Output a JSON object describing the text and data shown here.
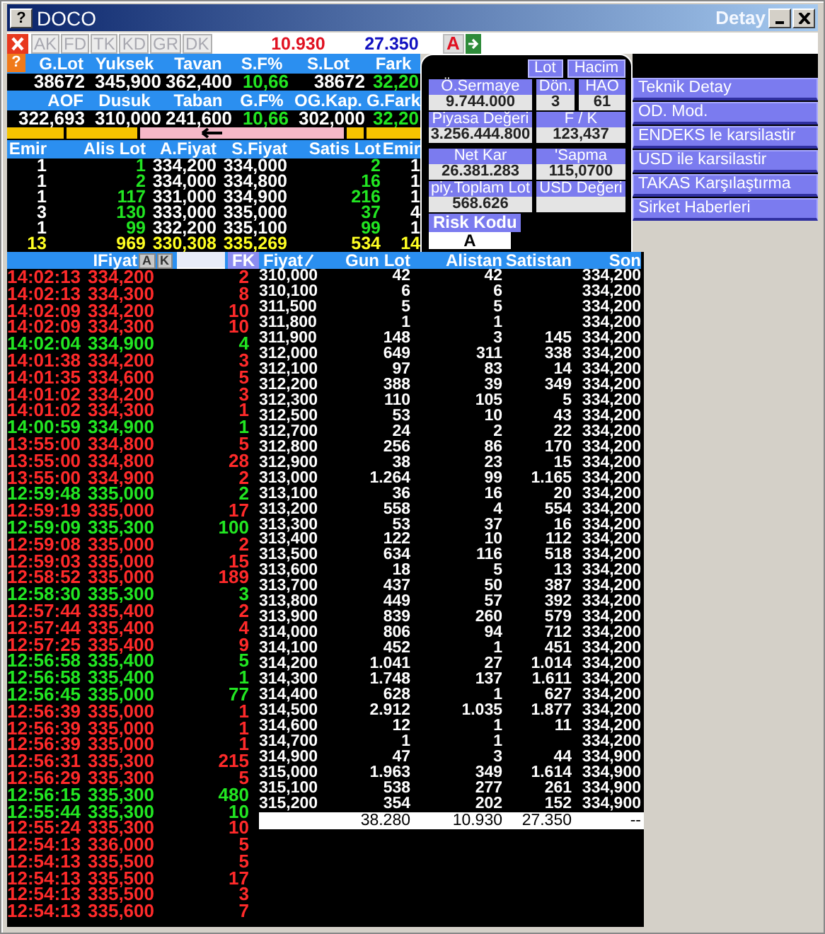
{
  "window": {
    "help_button": "?",
    "title": "DOCO",
    "detail_title": "Detay"
  },
  "toolbar": {
    "tabs": [
      {
        "label": "AK",
        "disabled": true
      },
      {
        "label": "FD",
        "disabled": true
      },
      {
        "label": "TK",
        "disabled": true
      },
      {
        "label": "KD",
        "disabled": true
      },
      {
        "label": "GR",
        "disabled": true
      },
      {
        "label": "DK",
        "disabled": true
      }
    ],
    "buy_total": "10.930",
    "sell_total": "27.350",
    "a_button": "A"
  },
  "stats": {
    "help_button": "?",
    "items": [
      {
        "label": "G.Lot",
        "value": "38672",
        "positive": false
      },
      {
        "label": "Yuksek",
        "value": "345,900",
        "positive": false
      },
      {
        "label": "Tavan",
        "value": "362,400",
        "positive": false
      },
      {
        "label": "S.F%",
        "value": "10,66",
        "positive": true
      },
      {
        "label": "S.Lot",
        "value": "38672",
        "positive": false
      },
      {
        "label": "Fark",
        "value": "32,20",
        "positive": true
      },
      {
        "label": "AOF",
        "value": "322,693",
        "positive": false
      },
      {
        "label": "Dusuk",
        "value": "310,000",
        "positive": false
      },
      {
        "label": "Taban",
        "value": "241,600",
        "positive": false
      },
      {
        "label": "G.F%",
        "value": "10,66",
        "positive": true
      },
      {
        "label": "OG.Kap.",
        "value": "302,000",
        "positive": false
      },
      {
        "label": "G.Fark",
        "value": "32,20",
        "positive": true
      }
    ]
  },
  "order_book": {
    "columns": [
      "Emir",
      "Alis Lot",
      "A.Fiyat",
      "S.Fiyat",
      "Satis Lot",
      "Emir"
    ],
    "rows": [
      [
        "1",
        "1",
        "334,200",
        "334,000",
        "2",
        "1"
      ],
      [
        "1",
        "2",
        "334,000",
        "334,800",
        "16",
        "1"
      ],
      [
        "1",
        "117",
        "331,000",
        "334,900",
        "216",
        "1"
      ],
      [
        "3",
        "130",
        "333,000",
        "335,000",
        "37",
        "4"
      ],
      [
        "1",
        "99",
        "332,200",
        "335,100",
        "99",
        "1"
      ]
    ],
    "total": [
      "13",
      "969",
      "330,308",
      "335,269",
      "534",
      "14"
    ]
  },
  "detail": {
    "buttons": [
      "Lot",
      "Hacim"
    ],
    "fields": [
      {
        "label": "Ö.Sermaye",
        "value": "9.744.000"
      },
      {
        "label": "Dön.",
        "value": "3"
      },
      {
        "label": "HAO",
        "value": "61"
      },
      {
        "label": "Piyasa Değeri",
        "value": "3.256.444.800"
      },
      {
        "label": "F / K",
        "value": "123,437"
      },
      {
        "label": "Net Kar",
        "value": "26.381.283"
      },
      {
        "label": "'Sapma",
        "value": "115,0700"
      },
      {
        "label": "piy.Toplam Lot",
        "value": "568.626"
      },
      {
        "label": "USD Değeri"
      },
      {
        "label": "Risk Kodu",
        "value": "A"
      }
    ]
  },
  "menu": [
    "Teknik Detay",
    "OD. Mod.",
    "ENDEKS le karsilastir",
    "USD ile karsilastir",
    "TAKAS Karşılaştırma",
    "Sirket Haberleri"
  ],
  "trades_header": {
    "price_label": "IFiyat",
    "a_button": "A",
    "k_button": "K",
    "fk_button": "FK"
  },
  "trades": [
    {
      "time": "14:02:13",
      "price": "334,200",
      "lot": "2",
      "uptick": false
    },
    {
      "time": "14:02:13",
      "price": "334,300",
      "lot": "8",
      "uptick": false
    },
    {
      "time": "14:02:09",
      "price": "334,200",
      "lot": "10",
      "uptick": false
    },
    {
      "time": "14:02:09",
      "price": "334,300",
      "lot": "10",
      "uptick": false
    },
    {
      "time": "14:02:04",
      "price": "334,900",
      "lot": "4",
      "uptick": true
    },
    {
      "time": "14:01:38",
      "price": "334,200",
      "lot": "3",
      "uptick": false
    },
    {
      "time": "14:01:35",
      "price": "334,600",
      "lot": "5",
      "uptick": false
    },
    {
      "time": "14:01:02",
      "price": "334,200",
      "lot": "3",
      "uptick": false
    },
    {
      "time": "14:01:02",
      "price": "334,300",
      "lot": "1",
      "uptick": false
    },
    {
      "time": "14:00:59",
      "price": "334,900",
      "lot": "1",
      "uptick": true
    },
    {
      "time": "13:55:00",
      "price": "334,800",
      "lot": "5",
      "uptick": false
    },
    {
      "time": "13:55:00",
      "price": "334,800",
      "lot": "28",
      "uptick": false
    },
    {
      "time": "13:55:00",
      "price": "334,900",
      "lot": "2",
      "uptick": false
    },
    {
      "time": "12:59:48",
      "price": "335,000",
      "lot": "2",
      "uptick": true
    },
    {
      "time": "12:59:19",
      "price": "335,000",
      "lot": "17",
      "uptick": false
    },
    {
      "time": "12:59:09",
      "price": "335,300",
      "lot": "100",
      "uptick": true
    },
    {
      "time": "12:59:08",
      "price": "335,000",
      "lot": "2",
      "uptick": false
    },
    {
      "time": "12:59:03",
      "price": "335,000",
      "lot": "15",
      "uptick": false
    },
    {
      "time": "12:58:52",
      "price": "335,000",
      "lot": "189",
      "uptick": false
    },
    {
      "time": "12:58:30",
      "price": "335,300",
      "lot": "3",
      "uptick": true
    },
    {
      "time": "12:57:44",
      "price": "335,400",
      "lot": "2",
      "uptick": false
    },
    {
      "time": "12:57:44",
      "price": "335,400",
      "lot": "4",
      "uptick": false
    },
    {
      "time": "12:57:25",
      "price": "335,400",
      "lot": "9",
      "uptick": false
    },
    {
      "time": "12:56:58",
      "price": "335,400",
      "lot": "5",
      "uptick": true
    },
    {
      "time": "12:56:58",
      "price": "335,400",
      "lot": "1",
      "uptick": true
    },
    {
      "time": "12:56:45",
      "price": "335,000",
      "lot": "77",
      "uptick": true
    },
    {
      "time": "12:56:39",
      "price": "335,000",
      "lot": "1",
      "uptick": false
    },
    {
      "time": "12:56:39",
      "price": "335,000",
      "lot": "1",
      "uptick": false
    },
    {
      "time": "12:56:39",
      "price": "335,000",
      "lot": "1",
      "uptick": false
    },
    {
      "time": "12:56:31",
      "price": "335,300",
      "lot": "215",
      "uptick": false
    },
    {
      "time": "12:56:29",
      "price": "335,300",
      "lot": "5",
      "uptick": false
    },
    {
      "time": "12:56:15",
      "price": "335,300",
      "lot": "480",
      "uptick": true
    },
    {
      "time": "12:55:44",
      "price": "335,300",
      "lot": "10",
      "uptick": true
    },
    {
      "time": "12:55:24",
      "price": "335,300",
      "lot": "10",
      "uptick": false
    },
    {
      "time": "12:54:13",
      "price": "336,000",
      "lot": "5",
      "uptick": false
    },
    {
      "time": "12:54:13",
      "price": "335,500",
      "lot": "5",
      "uptick": false
    },
    {
      "time": "12:54:13",
      "price": "335,500",
      "lot": "17",
      "uptick": false
    },
    {
      "time": "12:54:13",
      "price": "335,500",
      "lot": "3",
      "uptick": false
    },
    {
      "time": "12:54:13",
      "price": "335,600",
      "lot": "7",
      "uptick": false
    }
  ],
  "depth": {
    "columns": [
      {
        "label": "Fiyat",
        "sorted": true
      },
      {
        "label": "Gun Lot",
        "sorted": false
      },
      {
        "label": "Alistan",
        "sorted": false
      },
      {
        "label": "Satistan",
        "sorted": false
      },
      {
        "label": "Son",
        "sorted": false
      }
    ],
    "rows": [
      {
        "price": "310,000",
        "gun_lot": "42",
        "alistan": "42",
        "son": "334,200"
      },
      {
        "price": "310,100",
        "gun_lot": "6",
        "alistan": "6",
        "son": "334,200"
      },
      {
        "price": "311,500",
        "gun_lot": "5",
        "alistan": "5",
        "son": "334,200"
      },
      {
        "price": "311,800",
        "gun_lot": "1",
        "alistan": "1",
        "son": "334,200"
      },
      {
        "price": "311,900",
        "gun_lot": "148",
        "alistan": "3",
        "satistan": "145",
        "son": "334,200"
      },
      {
        "price": "312,000",
        "gun_lot": "649",
        "alistan": "311",
        "satistan": "338",
        "son": "334,200"
      },
      {
        "price": "312,100",
        "gun_lot": "97",
        "alistan": "83",
        "satistan": "14",
        "son": "334,200"
      },
      {
        "price": "312,200",
        "gun_lot": "388",
        "alistan": "39",
        "satistan": "349",
        "son": "334,200"
      },
      {
        "price": "312,300",
        "gun_lot": "110",
        "alistan": "105",
        "satistan": "5",
        "son": "334,200"
      },
      {
        "price": "312,500",
        "gun_lot": "53",
        "alistan": "10",
        "satistan": "43",
        "son": "334,200"
      },
      {
        "price": "312,700",
        "gun_lot": "24",
        "alistan": "2",
        "satistan": "22",
        "son": "334,200"
      },
      {
        "price": "312,800",
        "gun_lot": "256",
        "alistan": "86",
        "satistan": "170",
        "son": "334,200"
      },
      {
        "price": "312,900",
        "gun_lot": "38",
        "alistan": "23",
        "satistan": "15",
        "son": "334,200"
      },
      {
        "price": "313,000",
        "gun_lot": "1.264",
        "alistan": "99",
        "satistan": "1.165",
        "son": "334,200"
      },
      {
        "price": "313,100",
        "gun_lot": "36",
        "alistan": "16",
        "satistan": "20",
        "son": "334,200"
      },
      {
        "price": "313,200",
        "gun_lot": "558",
        "alistan": "4",
        "satistan": "554",
        "son": "334,200"
      },
      {
        "price": "313,300",
        "gun_lot": "53",
        "alistan": "37",
        "satistan": "16",
        "son": "334,200"
      },
      {
        "price": "313,400",
        "gun_lot": "122",
        "alistan": "10",
        "satistan": "112",
        "son": "334,200"
      },
      {
        "price": "313,500",
        "gun_lot": "634",
        "alistan": "116",
        "satistan": "518",
        "son": "334,200"
      },
      {
        "price": "313,600",
        "gun_lot": "18",
        "alistan": "5",
        "satistan": "13",
        "son": "334,200"
      },
      {
        "price": "313,700",
        "gun_lot": "437",
        "alistan": "50",
        "satistan": "387",
        "son": "334,200"
      },
      {
        "price": "313,800",
        "gun_lot": "449",
        "alistan": "57",
        "satistan": "392",
        "son": "334,200"
      },
      {
        "price": "313,900",
        "gun_lot": "839",
        "alistan": "260",
        "satistan": "579",
        "son": "334,200"
      },
      {
        "price": "314,000",
        "gun_lot": "806",
        "alistan": "94",
        "satistan": "712",
        "son": "334,200"
      },
      {
        "price": "314,100",
        "gun_lot": "452",
        "alistan": "1",
        "satistan": "451",
        "son": "334,200"
      },
      {
        "price": "314,200",
        "gun_lot": "1.041",
        "alistan": "27",
        "satistan": "1.014",
        "son": "334,200"
      },
      {
        "price": "314,300",
        "gun_lot": "1.748",
        "alistan": "137",
        "satistan": "1.611",
        "son": "334,200"
      },
      {
        "price": "314,400",
        "gun_lot": "628",
        "alistan": "1",
        "satistan": "627",
        "son": "334,200"
      },
      {
        "price": "314,500",
        "gun_lot": "2.912",
        "alistan": "1.035",
        "satistan": "1.877",
        "son": "334,200"
      },
      {
        "price": "314,600",
        "gun_lot": "12",
        "alistan": "1",
        "satistan": "11",
        "son": "334,200"
      },
      {
        "price": "314,700",
        "gun_lot": "1",
        "alistan": "1",
        "son": "334,200"
      },
      {
        "price": "314,900",
        "gun_lot": "47",
        "alistan": "3",
        "satistan": "44",
        "son": "334,900"
      },
      {
        "price": "315,000",
        "gun_lot": "1.963",
        "alistan": "349",
        "satistan": "1.614",
        "son": "334,900"
      },
      {
        "price": "315,100",
        "gun_lot": "538",
        "alistan": "277",
        "satistan": "261",
        "son": "334,900"
      },
      {
        "price": "315,200",
        "gun_lot": "354",
        "alistan": "202",
        "satistan": "152",
        "son": "334,900"
      }
    ],
    "total": {
      "gun_lot": "38.280",
      "alistan": "10.930",
      "satistan": "27.350",
      "son": "--"
    }
  }
}
